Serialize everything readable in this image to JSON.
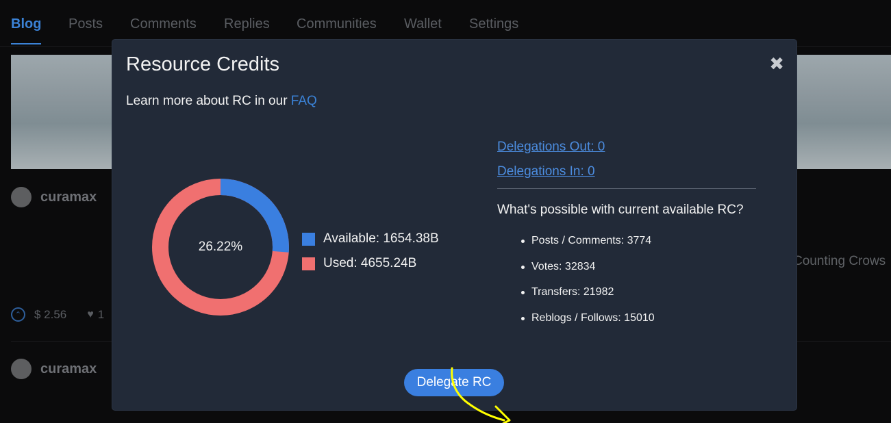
{
  "tabs": [
    {
      "label": "Blog",
      "active": true
    },
    {
      "label": "Posts"
    },
    {
      "label": "Comments"
    },
    {
      "label": "Replies"
    },
    {
      "label": "Communities"
    },
    {
      "label": "Wallet"
    },
    {
      "label": "Settings"
    }
  ],
  "background": {
    "author_1": "curamax",
    "author_2": "curamax",
    "post_snippet": "Counting Crows",
    "payout": "$ 2.56",
    "heart_count": "1"
  },
  "modal": {
    "title": "Resource Credits",
    "faq_prefix": "Learn more about RC in our ",
    "faq_link": "FAQ",
    "close_icon": "close-icon",
    "rc_chart": {
      "percent_label": "26.22%",
      "available_fraction": 0.2622,
      "available_label": "Available: 1654.38B",
      "used_label": "Used: 4655.24B",
      "available_color": "#3a7fe0",
      "used_color": "#f07070"
    },
    "delegations_out": "Delegations Out: 0",
    "delegations_in": "Delegations In: 0",
    "possible_title": "What's possible with current available RC?",
    "possible_items": [
      "Posts / Comments: 3774",
      "Votes: 32834",
      "Transfers: 21982",
      "Reblogs / Follows: 15010"
    ],
    "delegate_button": "Delegate RC"
  },
  "colors": {
    "accent": "#3b82d6",
    "modal_bg": "#222a38",
    "annotation": "#ffff00"
  }
}
